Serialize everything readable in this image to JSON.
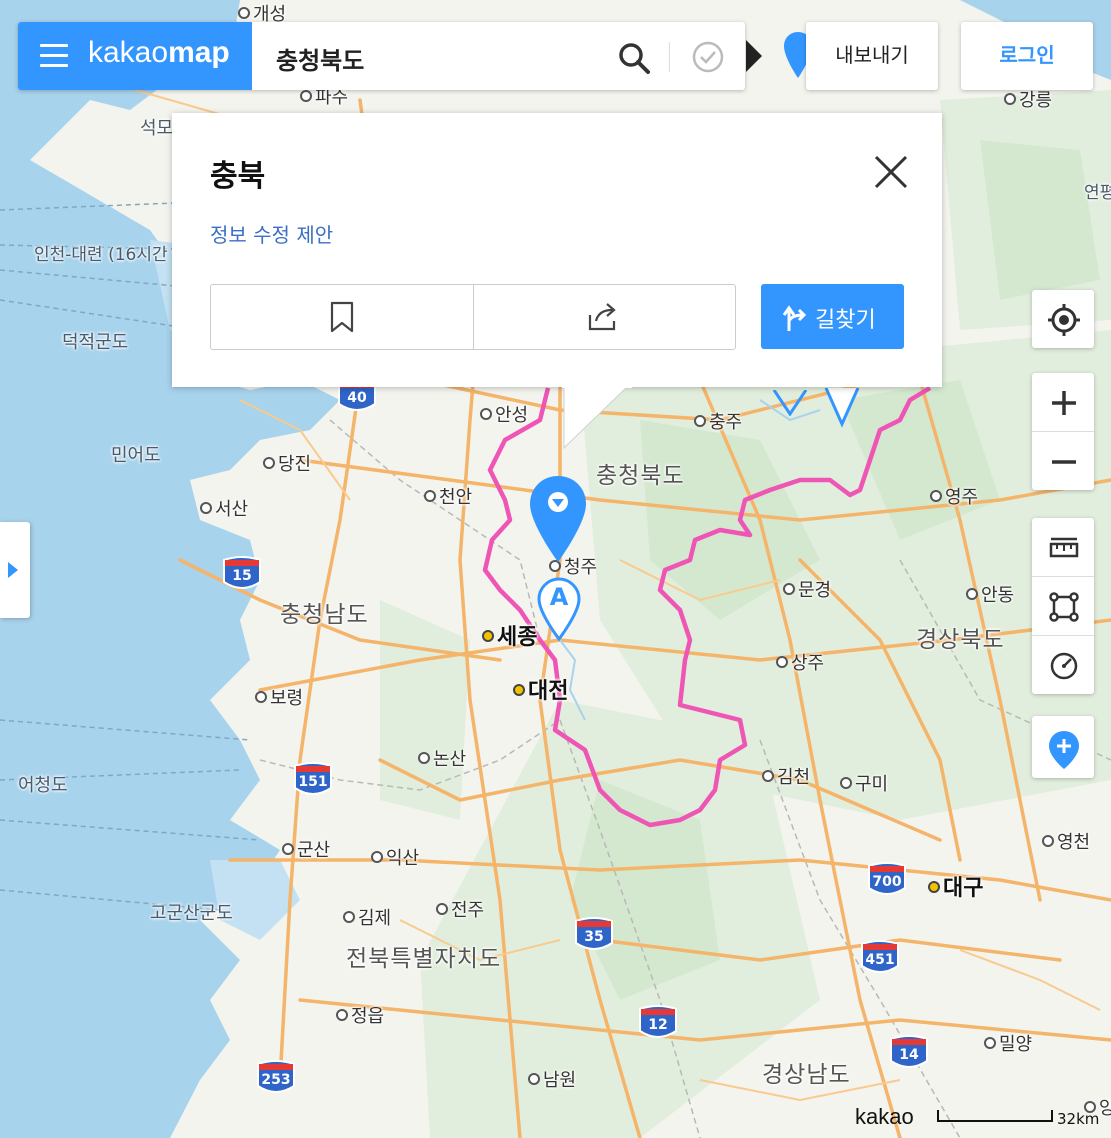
{
  "header": {
    "logo_prefix": "kakao",
    "logo_suffix": "map",
    "search_value": "충청북도",
    "export_label": "내보내기",
    "login_label": "로그인"
  },
  "popup": {
    "title": "충북",
    "suggest_link": "정보 수정 제안",
    "route_label": "길찾기"
  },
  "map": {
    "cities": [
      "개성",
      "파주",
      "강릉",
      "안성",
      "충주",
      "당진",
      "천안",
      "영주",
      "서산",
      "청주",
      "문경",
      "안동",
      "세종",
      "상주",
      "대전",
      "보령",
      "논산",
      "김천",
      "구미",
      "영천",
      "군산",
      "익산",
      "대구",
      "김제",
      "전주",
      "정읍",
      "밀양",
      "남원",
      "양산"
    ],
    "regions": [
      "충청북도",
      "충청남도",
      "경상북도",
      "전북특별자치도",
      "경상남도"
    ],
    "sea_labels": [
      "석모",
      "인천-대련 (16시간",
      "덕적군도",
      "민어도",
      "어청도",
      "고군산군도",
      "연평"
    ],
    "highways": [
      "40",
      "15",
      "151",
      "35",
      "700",
      "451",
      "12",
      "14",
      "253"
    ],
    "marker_label": "A",
    "boundary_color": "#ee55b5",
    "water_color": "#a8d3ec",
    "accent_color": "#3396ff"
  },
  "scale": {
    "brand": "kakao",
    "distance": "32km"
  }
}
